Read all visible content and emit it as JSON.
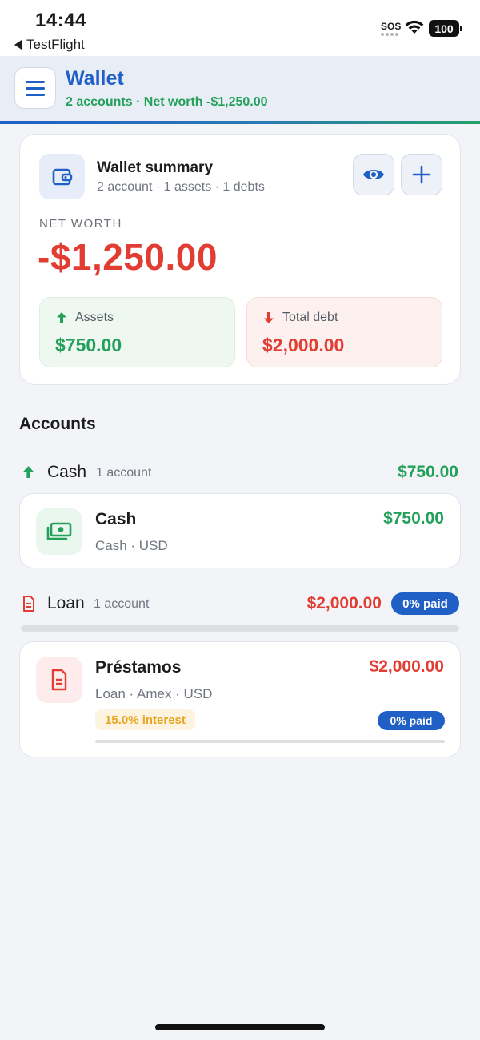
{
  "status_bar": {
    "time": "14:44",
    "back_app": "TestFlight",
    "sos": "SOS",
    "battery": "100"
  },
  "header": {
    "title": "Wallet",
    "subtitle": "2 accounts · Net worth -$1,250.00",
    "menu_icon": "hamburger-menu-icon"
  },
  "summary": {
    "title": "Wallet summary",
    "subtitle": "2 account · 1 assets · 1 debts",
    "net_worth_label": "NET WORTH",
    "net_worth_value": "-$1,250.00",
    "assets_label": "Assets",
    "assets_value": "$750.00",
    "debt_label": "Total debt",
    "debt_value": "$2,000.00",
    "icons": [
      "wallet-icon",
      "eye-icon",
      "plus-icon",
      "arrow-up-icon",
      "arrow-down-icon"
    ]
  },
  "accounts": {
    "title": "Accounts",
    "groups": [
      {
        "name": "Cash",
        "count": "1 account",
        "total": "$750.00",
        "icon": "arrow-up-icon",
        "items": [
          {
            "name": "Cash",
            "subtitle": "Cash · USD",
            "amount": "$750.00",
            "icon": "banknote-icon"
          }
        ]
      },
      {
        "name": "Loan",
        "count": "1 account",
        "total": "$2,000.00",
        "paid_label": "0% paid",
        "paid_fraction": 0,
        "icon": "document-icon",
        "items": [
          {
            "name": "Préstamos",
            "subtitle": "Loan · Amex · USD",
            "amount": "$2,000.00",
            "interest": "15.0% interest",
            "paid_label": "0% paid",
            "paid_fraction": 0,
            "icon": "document-icon"
          }
        ]
      }
    ]
  },
  "colors": {
    "accent_blue": "#1f5fc6",
    "positive_green": "#23a05a",
    "negative_red": "#e23d33",
    "interest_orange": "#e7a520"
  }
}
